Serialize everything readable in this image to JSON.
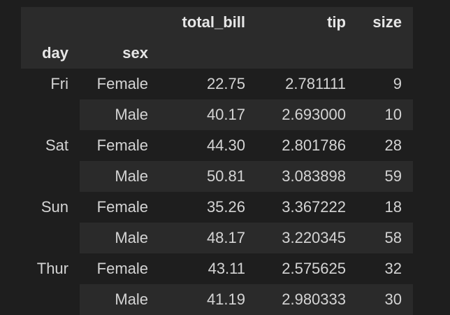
{
  "table": {
    "columns": [
      "total_bill",
      "tip",
      "size"
    ],
    "index_names": [
      "day",
      "sex"
    ],
    "rows": [
      {
        "day": "Fri",
        "sex": "Female",
        "total_bill": "22.75",
        "tip": "2.781111",
        "size": "9"
      },
      {
        "day": "",
        "sex": "Male",
        "total_bill": "40.17",
        "tip": "2.693000",
        "size": "10"
      },
      {
        "day": "Sat",
        "sex": "Female",
        "total_bill": "44.30",
        "tip": "2.801786",
        "size": "28"
      },
      {
        "day": "",
        "sex": "Male",
        "total_bill": "50.81",
        "tip": "3.083898",
        "size": "59"
      },
      {
        "day": "Sun",
        "sex": "Female",
        "total_bill": "35.26",
        "tip": "3.367222",
        "size": "18"
      },
      {
        "day": "",
        "sex": "Male",
        "total_bill": "48.17",
        "tip": "3.220345",
        "size": "58"
      },
      {
        "day": "Thur",
        "sex": "Female",
        "total_bill": "43.11",
        "tip": "2.575625",
        "size": "32"
      },
      {
        "day": "",
        "sex": "Male",
        "total_bill": "41.19",
        "tip": "2.980333",
        "size": "30"
      }
    ]
  },
  "colors": {
    "background": "#1e1e1e",
    "header_background": "#2b2b2b",
    "stripe_background": "#2a2a2a",
    "text": "#d4d4d4"
  }
}
